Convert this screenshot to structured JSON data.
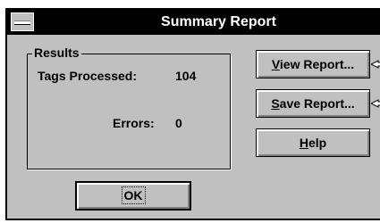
{
  "window": {
    "title": "Summary Report",
    "system_menu_icon": "system-menu-icon"
  },
  "results": {
    "legend": "Results",
    "tags_processed_label": "Tags Processed:",
    "tags_processed_value": "104",
    "errors_label": "Errors:",
    "errors_value": "0"
  },
  "buttons": {
    "view_report": {
      "mnemonic": "V",
      "rest": "iew Report..."
    },
    "save_report": {
      "mnemonic": "S",
      "rest": "ave Report..."
    },
    "help": {
      "mnemonic": "H",
      "rest": "elp"
    },
    "ok": "OK"
  },
  "colors": {
    "face": "#c0c0c0",
    "titlebar": "#000000",
    "title_text": "#ffffff",
    "shadow": "#808080",
    "highlight": "#ffffff"
  }
}
